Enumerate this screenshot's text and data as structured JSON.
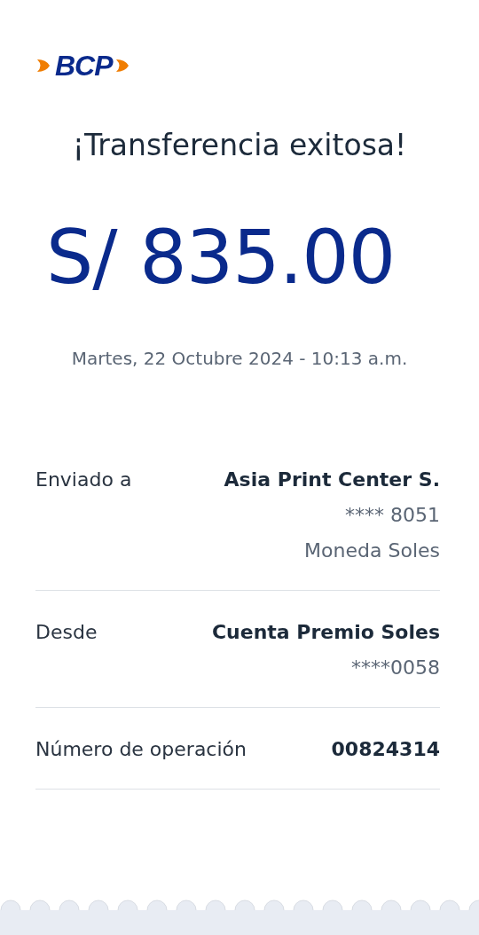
{
  "logo": {
    "text": "BCP"
  },
  "title": "¡Transferencia exitosa!",
  "amount": "S/ 835.00",
  "date": "Martes, 22 Octubre 2024 - 10:13 a.m.",
  "details": [
    {
      "label": "Enviado a",
      "value": "Asia Print Center S.",
      "extra": [
        "**** 8051",
        "Moneda Soles"
      ]
    },
    {
      "label": "Desde",
      "value": "Cuenta Premio Soles",
      "extra": [
        "****0058"
      ]
    },
    {
      "label": "Número de operación",
      "value": "00824314"
    }
  ]
}
